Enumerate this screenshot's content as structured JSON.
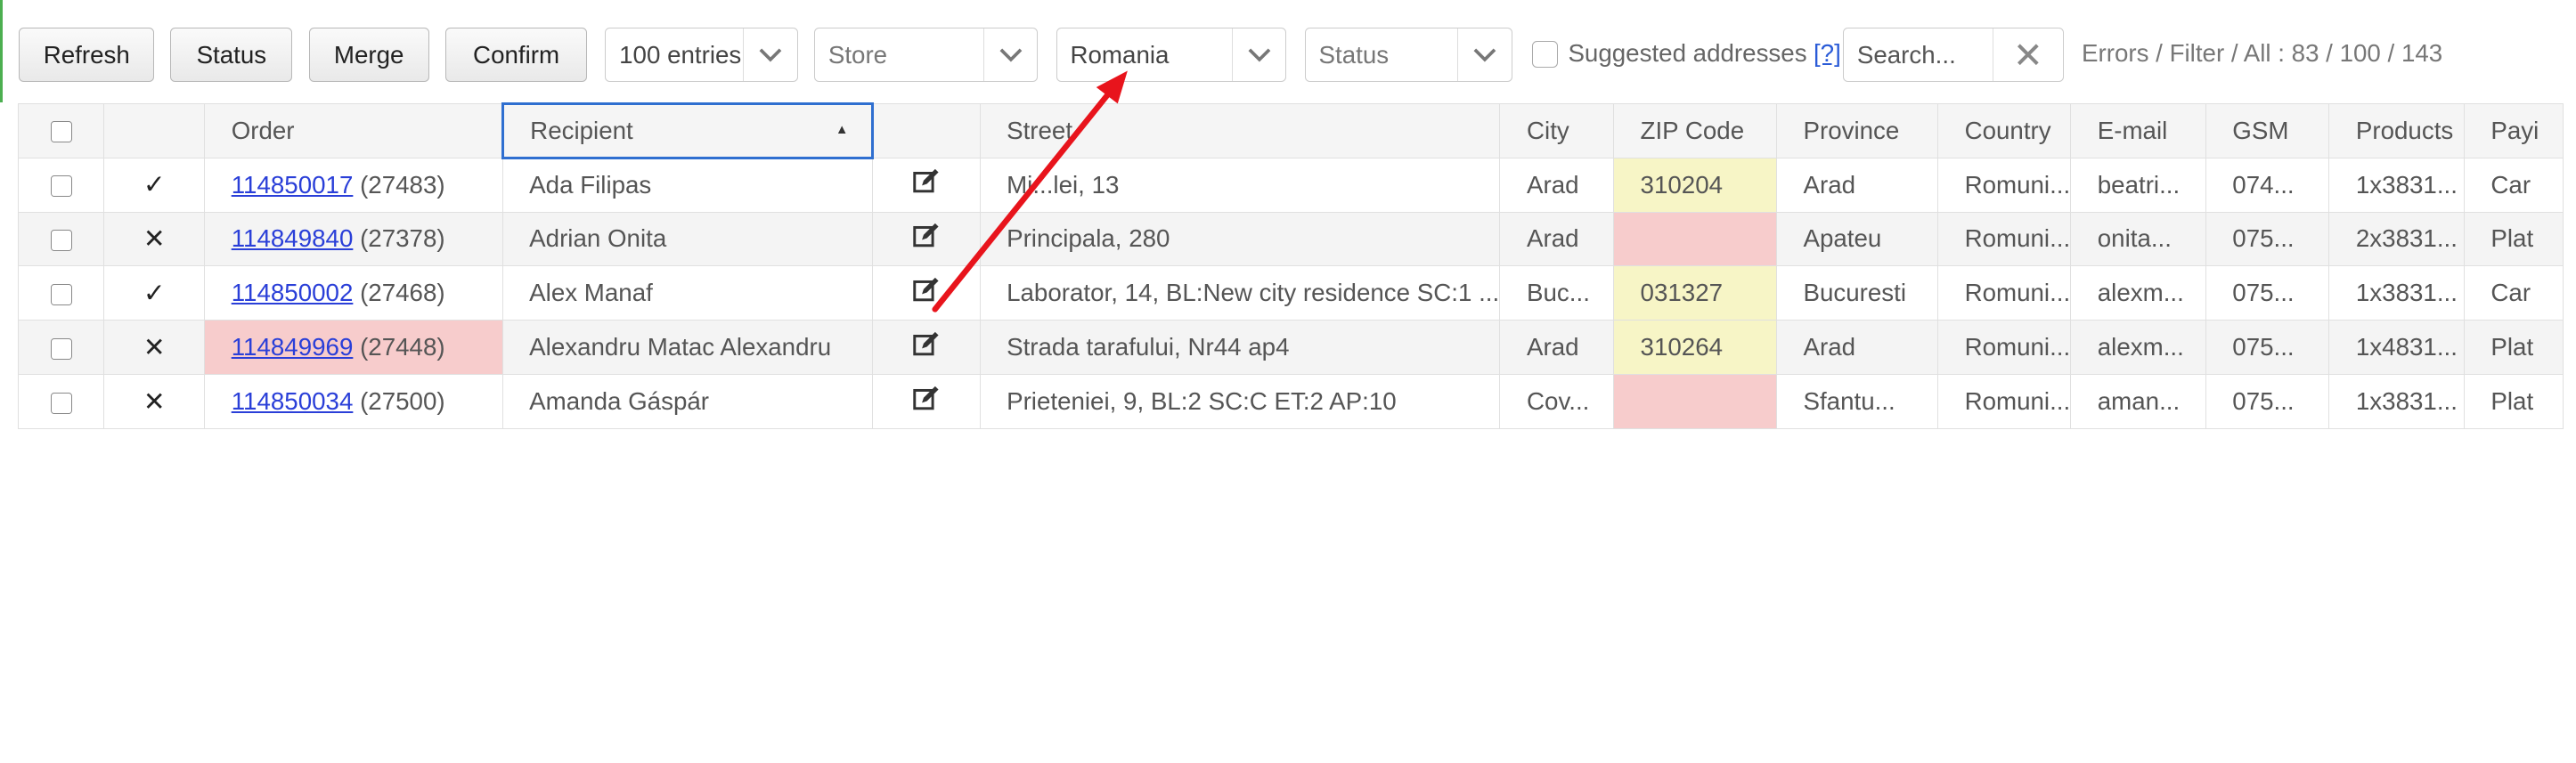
{
  "toolbar": {
    "refresh_label": "Refresh",
    "status_label": "Status",
    "merge_label": "Merge",
    "confirm_label": "Confirm",
    "entries_value": "100 entries",
    "store_placeholder": "Store",
    "country_value": "Romania",
    "status_placeholder": "Status",
    "suggested_label": "Suggested addresses",
    "suggested_help": "[?]",
    "search_placeholder": "Search...",
    "stats_text": "Errors / Filter / All : 83 / 100 / 143"
  },
  "table": {
    "headers": {
      "order": "Order",
      "recipient": "Recipient",
      "street": "Street",
      "city": "City",
      "zip": "ZIP Code",
      "province": "Province",
      "country": "Country",
      "email": "E-mail",
      "gsm": "GSM",
      "products": "Products",
      "payment": "Payi"
    },
    "sort_indicator": "▲",
    "rows": [
      {
        "mark": "✓",
        "order": "114850017",
        "order_ref": "(27483)",
        "recipient": "Ada Filipas",
        "street": "Mi...lei, 13",
        "city": "Arad",
        "zip": "310204",
        "province": "Arad",
        "country": "Romuni...",
        "email": "beatri...",
        "gsm": "074...",
        "products": "1x3831...",
        "payment": "Car"
      },
      {
        "mark": "✕",
        "order": "114849840",
        "order_ref": "(27378)",
        "recipient": "Adrian Onita",
        "street": "Principala, 280",
        "city": "Arad",
        "zip": "",
        "province": "Apateu",
        "country": "Romuni...",
        "email": "onita...",
        "gsm": "075...",
        "products": "2x3831...",
        "payment": "Plat"
      },
      {
        "mark": "✓",
        "order": "114850002",
        "order_ref": "(27468)",
        "recipient": "Alex Manaf",
        "street": "Laborator, 14, BL:New city residence SC:1 ...",
        "city": "Buc...",
        "zip": "031327",
        "province": "Bucuresti",
        "country": "Romuni...",
        "email": "alexm...",
        "gsm": "075...",
        "products": "1x3831...",
        "payment": "Car"
      },
      {
        "mark": "✕",
        "order": "114849969",
        "order_ref": "(27448)",
        "recipient": "Alexandru Matac Alexandru",
        "street": "Strada tarafului, Nr44 ap4",
        "city": "Arad",
        "zip": "310264",
        "province": "Arad",
        "country": "Romuni...",
        "email": "alexm...",
        "gsm": "075...",
        "products": "1x4831...",
        "payment": "Plat"
      },
      {
        "mark": "✕",
        "order": "114850034",
        "order_ref": "(27500)",
        "recipient": "Amanda Gáspár",
        "street": "Prieteniei, 9, BL:2 SC:C ET:2 AP:10",
        "city": "Cov...",
        "zip": "",
        "province": "Sfantu...",
        "country": "Romuni...",
        "email": "aman...",
        "gsm": "075...",
        "products": "1x3831...",
        "payment": "Plat"
      }
    ]
  },
  "annotation_color": "#e8141c"
}
